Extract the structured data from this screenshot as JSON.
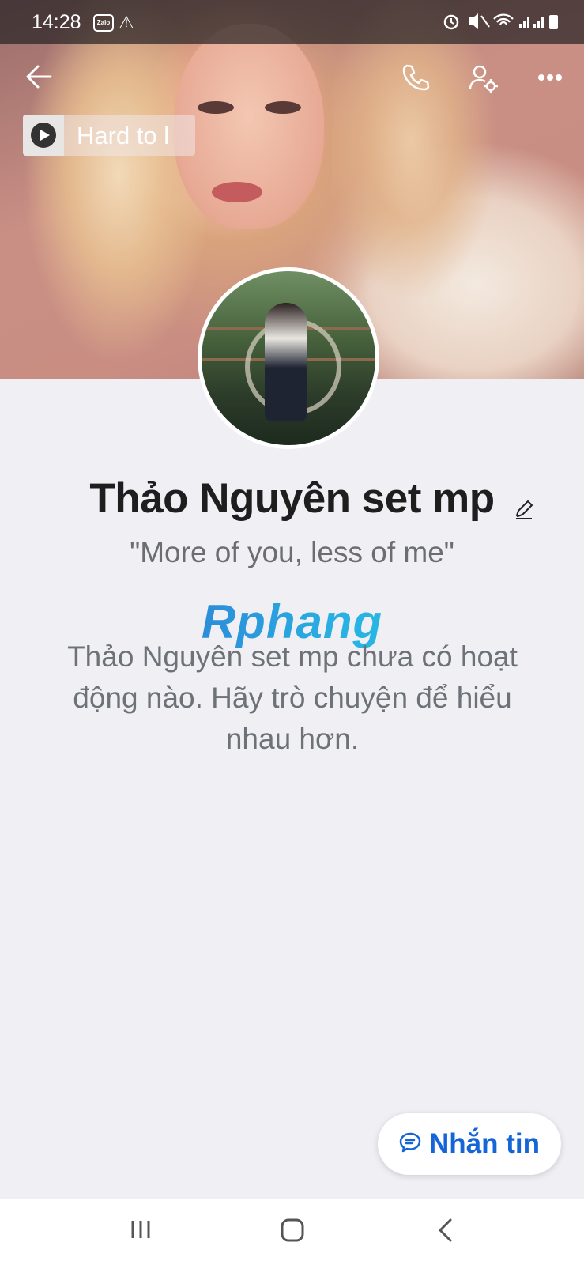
{
  "status_bar": {
    "time": "14:28",
    "app_badge": "Zalo",
    "warning_icon": "warning-icon",
    "right_icons": [
      "alarm-icon",
      "mute-icon",
      "wifi-icon",
      "signal-icon",
      "signal-icon",
      "battery-icon"
    ]
  },
  "top_nav": {
    "back_icon": "back-arrow-icon",
    "call_icon": "phone-icon",
    "settings_icon": "user-settings-icon",
    "more_icon": "more-dots-icon"
  },
  "music": {
    "title": "Hard to l",
    "icon": "play-icon"
  },
  "profile": {
    "name": "Thảo Nguyên set mp",
    "status": "\"More of you, less of me\"",
    "edit_icon": "pencil-icon"
  },
  "watermark": "Rphang",
  "empty_state": {
    "message": "Thảo Nguyên set mp chưa có hoạt động nào. Hãy trò chuyện để hiểu nhau hơn."
  },
  "message_button": {
    "label": "Nhắn tin",
    "icon": "chat-bubble-icon",
    "color": "#1565d8"
  },
  "system_nav": {
    "recents_icon": "recents-icon",
    "home_icon": "home-icon",
    "back_icon": "system-back-icon"
  }
}
